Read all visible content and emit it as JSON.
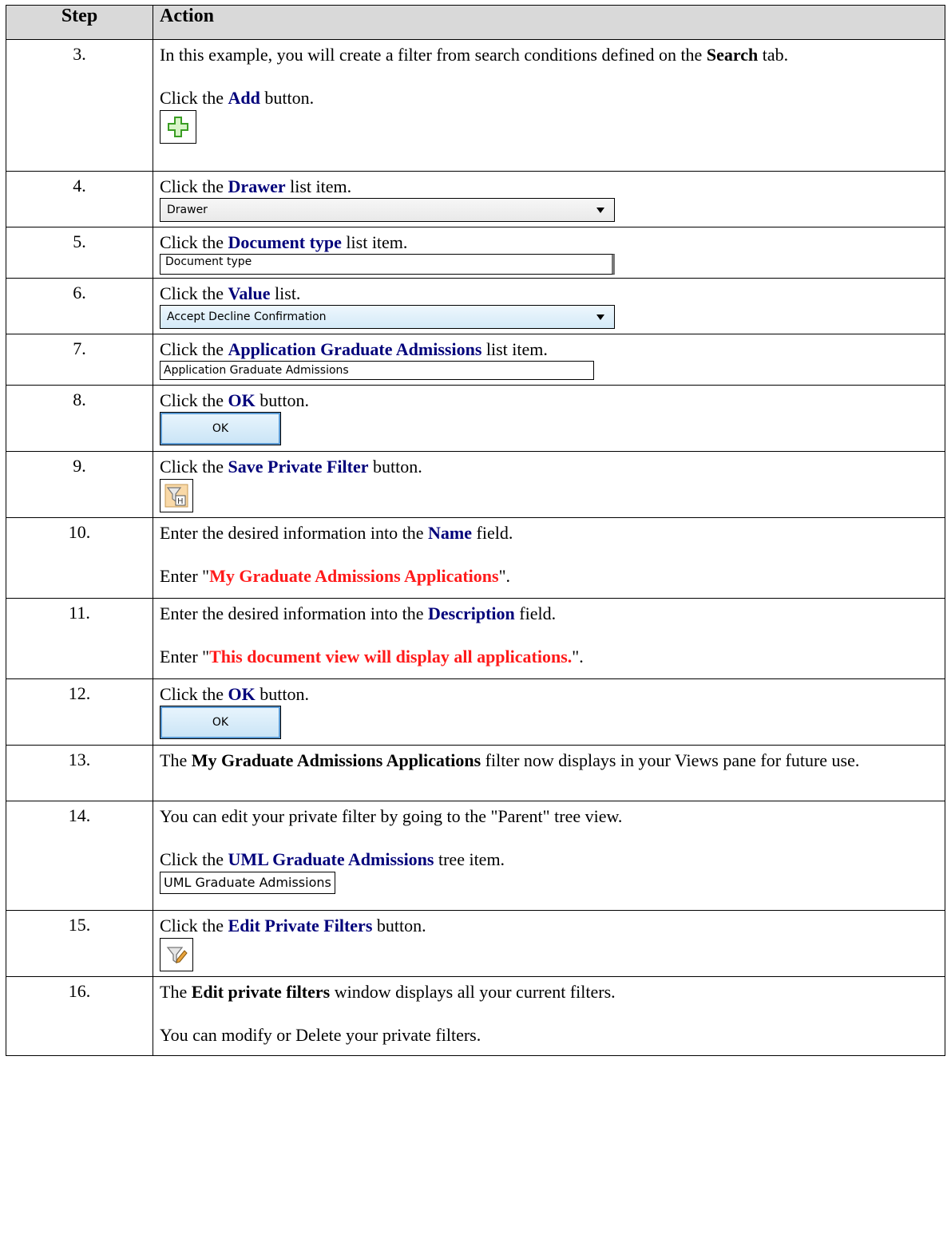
{
  "header": {
    "step": "Step",
    "action": "Action"
  },
  "rows": [
    {
      "num": "3.",
      "p1": "In this example, you will create a filter from search conditions defined on the ",
      "p1_bold": "Search",
      "p1_end": " tab.",
      "p2_pre": "Click the ",
      "p2_kw": "Add",
      "p2_post": " button.",
      "icon": "add-plus-icon"
    },
    {
      "num": "4.",
      "pre": "Click the ",
      "kw": "Drawer",
      "post": " list item.",
      "dropdown": "Drawer"
    },
    {
      "num": "5.",
      "pre": "Click the ",
      "kw": "Document type",
      "post": " list item.",
      "list_item": "Document type"
    },
    {
      "num": "6.",
      "pre": "Click the ",
      "kw": "Value",
      "post": " list.",
      "dropdown": "Accept Decline Confirmation"
    },
    {
      "num": "7.",
      "pre": "Click the ",
      "kw": "Application Graduate Admissions",
      "post": " list item.",
      "list_item": "Application Graduate Admissions"
    },
    {
      "num": "8.",
      "pre": "Click the ",
      "kw": "OK",
      "post": " button.",
      "button": "OK"
    },
    {
      "num": "9.",
      "pre": "Click the ",
      "kw": "Save Private Filter",
      "post": " button.",
      "icon": "save-filter-icon"
    },
    {
      "num": "10.",
      "pre": "Enter the desired information into the ",
      "kw": "Name",
      "post": " field.",
      "e_pre": "Enter \"",
      "e_val": "My Graduate Admissions Applications",
      "e_post": "\"."
    },
    {
      "num": "11.",
      "pre": "Enter the desired information into the ",
      "kw": "Description",
      "post": " field.",
      "e_pre": "Enter \"",
      "e_val": "This document view will display all applications.",
      "e_post": "\"."
    },
    {
      "num": "12.",
      "pre": "Click the ",
      "kw": "OK",
      "post": " button.",
      "button": "OK"
    },
    {
      "num": "13.",
      "pre": "The ",
      "bold": "My Graduate Admissions Applications",
      "post": " filter now displays in your Views pane for future use."
    },
    {
      "num": "14.",
      "p1": "You can edit your private filter by going to the \"Parent\" tree view.",
      "pre": "Click the ",
      "kw": "UML Graduate Admissions",
      "post": " tree item.",
      "tree_item": "UML Graduate Admissions"
    },
    {
      "num": "15.",
      "pre": "Click the ",
      "kw": "Edit Private Filters",
      "post": " button.",
      "icon": "edit-filter-icon"
    },
    {
      "num": "16.",
      "pre": "The ",
      "bold": "Edit private filters",
      "post": " window displays all your current filters.",
      "p2": "You can modify or Delete your private filters."
    }
  ]
}
